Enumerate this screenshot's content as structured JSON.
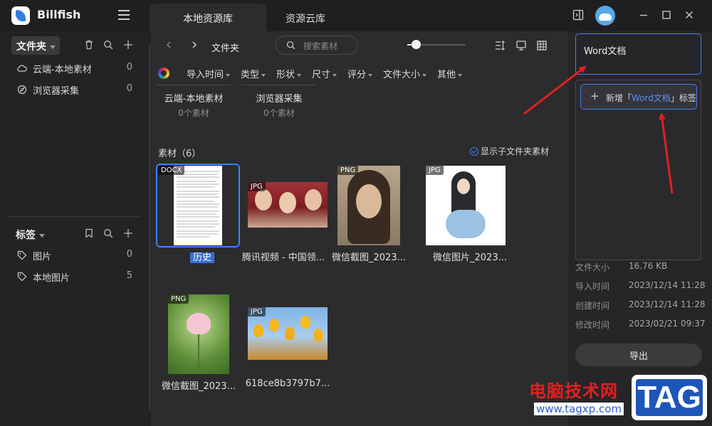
{
  "app": {
    "name": "Billfish"
  },
  "tabs": [
    {
      "label": "本地资源库",
      "active": true
    },
    {
      "label": "资源云库",
      "active": false
    }
  ],
  "sidebar": {
    "folder_section_label": "文件夹",
    "folders": [
      {
        "label": "云端-本地素材",
        "count": "0"
      },
      {
        "label": "浏览器采集",
        "count": "0"
      }
    ],
    "tag_section_label": "标签",
    "tags": [
      {
        "label": "图片",
        "count": "0"
      },
      {
        "label": "本地图片",
        "count": "5"
      }
    ]
  },
  "toolbar": {
    "breadcrumb": "文件夹",
    "search_placeholder": "搜索素材",
    "thumbnail_size_fraction": 0.15
  },
  "filters": [
    "导入时间",
    "类型",
    "形状",
    "尺寸",
    "评分",
    "文件大小",
    "其他"
  ],
  "subfolders": [
    {
      "name": "云端-本地素材",
      "count": "0个素材"
    },
    {
      "name": "浏览器采集",
      "count": "0个素材"
    }
  ],
  "assets": {
    "title": "素材（6）",
    "show_subfolder_label": "显示子文件夹素材",
    "items": [
      {
        "type": "DOCX",
        "name": "历史",
        "selected": true
      },
      {
        "type": "JPG",
        "name": "腾讯视频 - 中国领..."
      },
      {
        "type": "PNG",
        "name": "微信截图_2023..."
      },
      {
        "type": "JPG",
        "name": "微信图片_2023..."
      },
      {
        "type": "PNG",
        "name": "微信截图_2023..."
      },
      {
        "type": "JPG",
        "name": "618ce8b3797b7..."
      }
    ]
  },
  "right_panel": {
    "tag_input_value": "Word文档",
    "suggestion_prefix": "新增「",
    "suggestion_highlight": "Word文档",
    "suggestion_suffix": "」标签",
    "meta": [
      {
        "key": "文件大小",
        "value": "16.76 KB"
      },
      {
        "key": "导入时间",
        "value": "2023/12/14 11:28"
      },
      {
        "key": "创建时间",
        "value": "2023/12/14 11:28"
      },
      {
        "key": "修改时间",
        "value": "2023/02/21 09:37"
      }
    ],
    "export_label": "导出"
  },
  "watermark": {
    "site_name": "电脑技术网",
    "url": "www.tagxp.com",
    "logo_text": "TAG"
  },
  "colors": {
    "accent": "#3b82f6",
    "arrow": "#e02020",
    "background": "#2c2c2e"
  }
}
